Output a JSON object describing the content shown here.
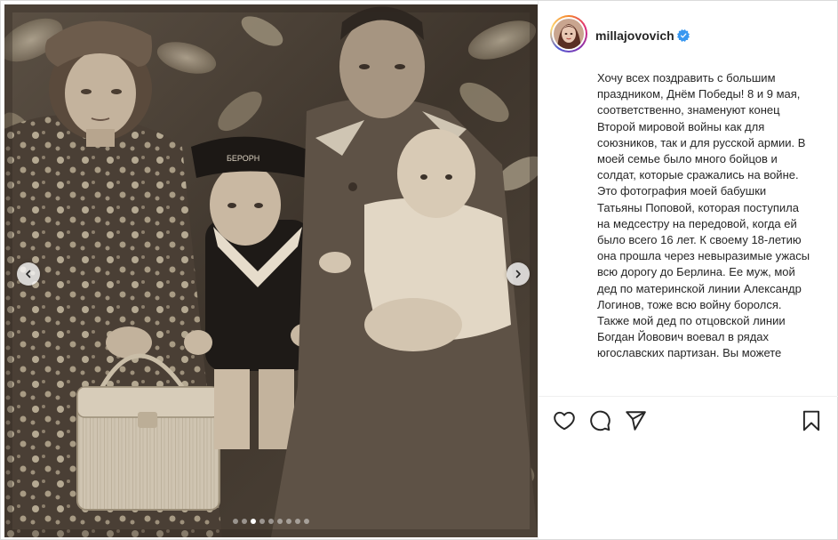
{
  "post": {
    "username": "millajovovich",
    "caption": "Хочу всех поздравить с большим праздником, Днём Победы! 8 и 9 мая, соответственно, знаменуют конец Второй мировой войны как для союзников, так и для русской армии. В моей семье было много бойцов и солдат, которые сражались на войне. Это фотография моей бабушки Татьяны Поповой, которая поступила на медсестру на передовой, когда ей было всего 16 лет. К своему 18-летию она прошла через невыразимые ужасы всю дорогу до Берлина. Ее муж, мой дед по материнской линии Александр Логинов, тоже всю войну боролся. Также мой дед по отцовской линии Богдан Йовович воевал в рядах югославских партизан. Вы можете",
    "cap_text": "БЕРОРН"
  },
  "carousel": {
    "slide_count": 9,
    "active_index": 2
  },
  "icons": {
    "verified": "verified-badge-icon",
    "like": "heart-icon",
    "comment": "comment-bubble-icon",
    "share": "paper-plane-icon",
    "save": "bookmark-icon",
    "prev": "chevron-left-icon",
    "next": "chevron-right-icon"
  },
  "colors": {
    "verified_blue": "#3897f0",
    "text": "#262626",
    "border": "#dbdbdb"
  }
}
